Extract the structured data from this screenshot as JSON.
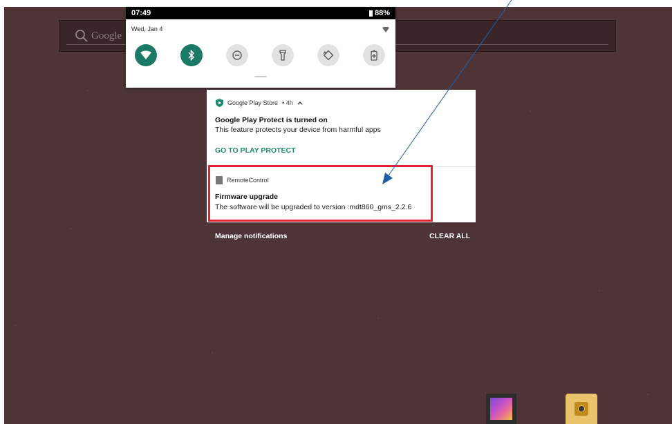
{
  "status_bar": {
    "time": "07:49",
    "battery": "88%"
  },
  "quick_settings": {
    "date": "Wed, Jan 4",
    "tiles": [
      {
        "icon": "wifi-icon",
        "state": "on"
      },
      {
        "icon": "bluetooth-icon",
        "state": "on"
      },
      {
        "icon": "do-not-disturb-icon",
        "state": "off"
      },
      {
        "icon": "flashlight-icon",
        "state": "off"
      },
      {
        "icon": "auto-rotate-icon",
        "state": "off"
      },
      {
        "icon": "battery-saver-icon",
        "state": "off"
      }
    ]
  },
  "search_bar": {
    "text": "Google"
  },
  "notifications": [
    {
      "app": "Google Play Store",
      "meta": "• 4h",
      "title": "Google Play Protect is turned on",
      "body": "This feature protects your device from harmful apps",
      "action": "GO TO PLAY PROTECT",
      "icon": "play-protect-icon"
    },
    {
      "app": "RemoteControl",
      "title": "Firmware upgrade",
      "body": "The software will be upgraded to version :mdt860_gms_2.2.6",
      "icon": "remote-control-app-icon"
    }
  ],
  "footer": {
    "manage": "Manage notifications",
    "clear_all": "CLEAR ALL"
  },
  "colors": {
    "accent": "#1a7a66",
    "highlight": "#e0232e",
    "arrow": "#1f5fa8",
    "wallpaper": "#4e3437"
  }
}
